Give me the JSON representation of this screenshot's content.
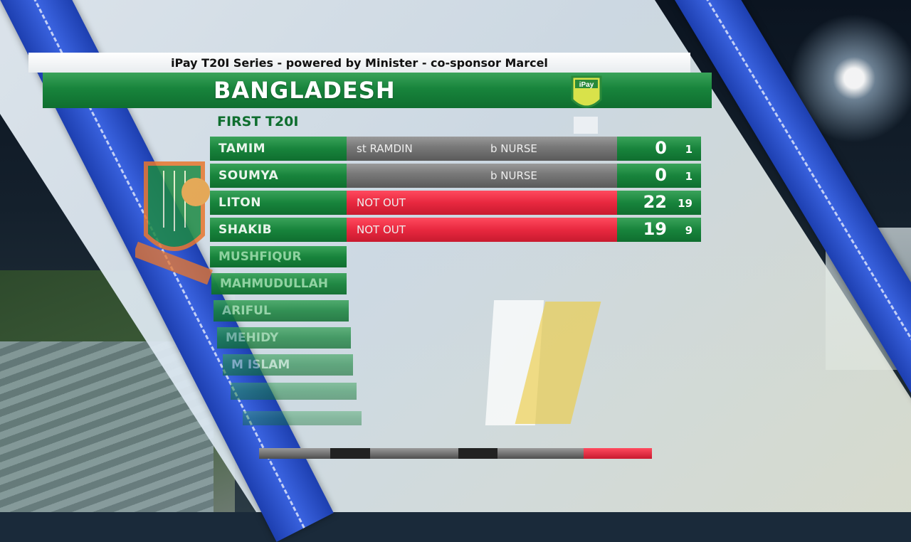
{
  "series_title": "iPay T20I Series - powered by Minister - co-sponsor Marcel",
  "team": "BANGLADESH",
  "match": "FIRST T20I",
  "logo": {
    "name": "ipay-series-logo",
    "text": "iPay"
  },
  "colors": {
    "green": "#18843c",
    "red": "#e8283f",
    "blue_band": "#2f55d6"
  },
  "batsmen": [
    {
      "name": "TAMIM",
      "fielder": "st RAMDIN",
      "bowler": "b NURSE",
      "status": "out",
      "runs": "0",
      "balls": "1"
    },
    {
      "name": "SOUMYA",
      "fielder": "",
      "bowler": "b NURSE",
      "status": "out",
      "runs": "0",
      "balls": "1"
    },
    {
      "name": "LITON",
      "dismissal": "NOT OUT",
      "status": "not_out",
      "runs": "22",
      "balls": "19"
    },
    {
      "name": "SHAKIB",
      "dismissal": "NOT OUT",
      "status": "not_out",
      "runs": "19",
      "balls": "9"
    }
  ],
  "yet_to_bat": [
    "MUSHFIQUR",
    "MAHMUDULLAH",
    "ARIFUL",
    "MEHIDY",
    "M ISLAM"
  ]
}
